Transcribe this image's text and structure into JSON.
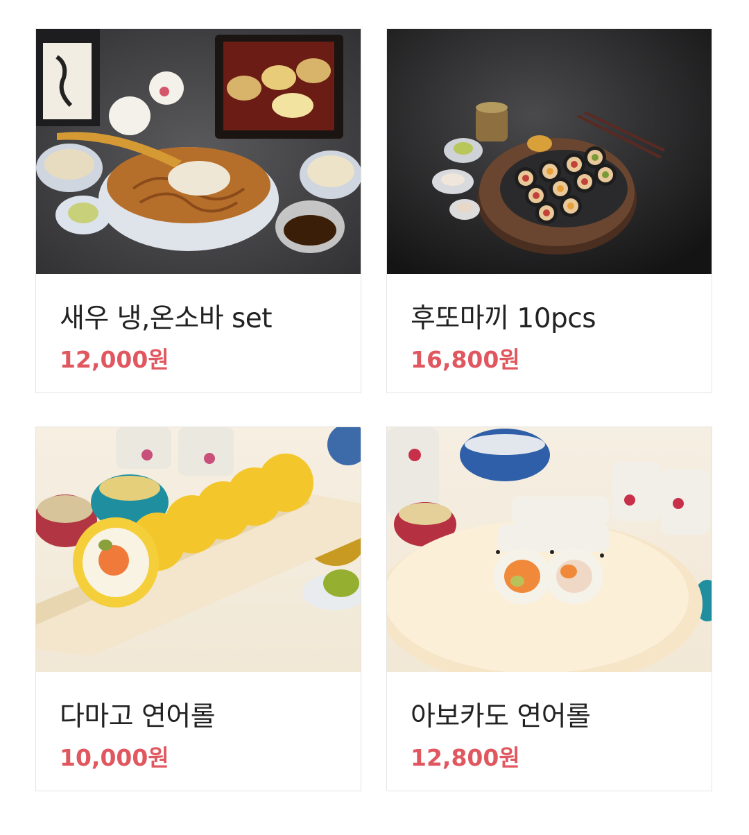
{
  "products": [
    {
      "name": "새우 냉,온소바 set",
      "price": "12,000원"
    },
    {
      "name": "후또마끼 10pcs",
      "price": "16,800원"
    },
    {
      "name": "다마고 연어롤",
      "price": "10,000원"
    },
    {
      "name": "아보카도 연어롤",
      "price": "12,800원"
    }
  ],
  "colors": {
    "price": "#e0575f",
    "name": "#222222",
    "border": "#e3e3e3"
  }
}
